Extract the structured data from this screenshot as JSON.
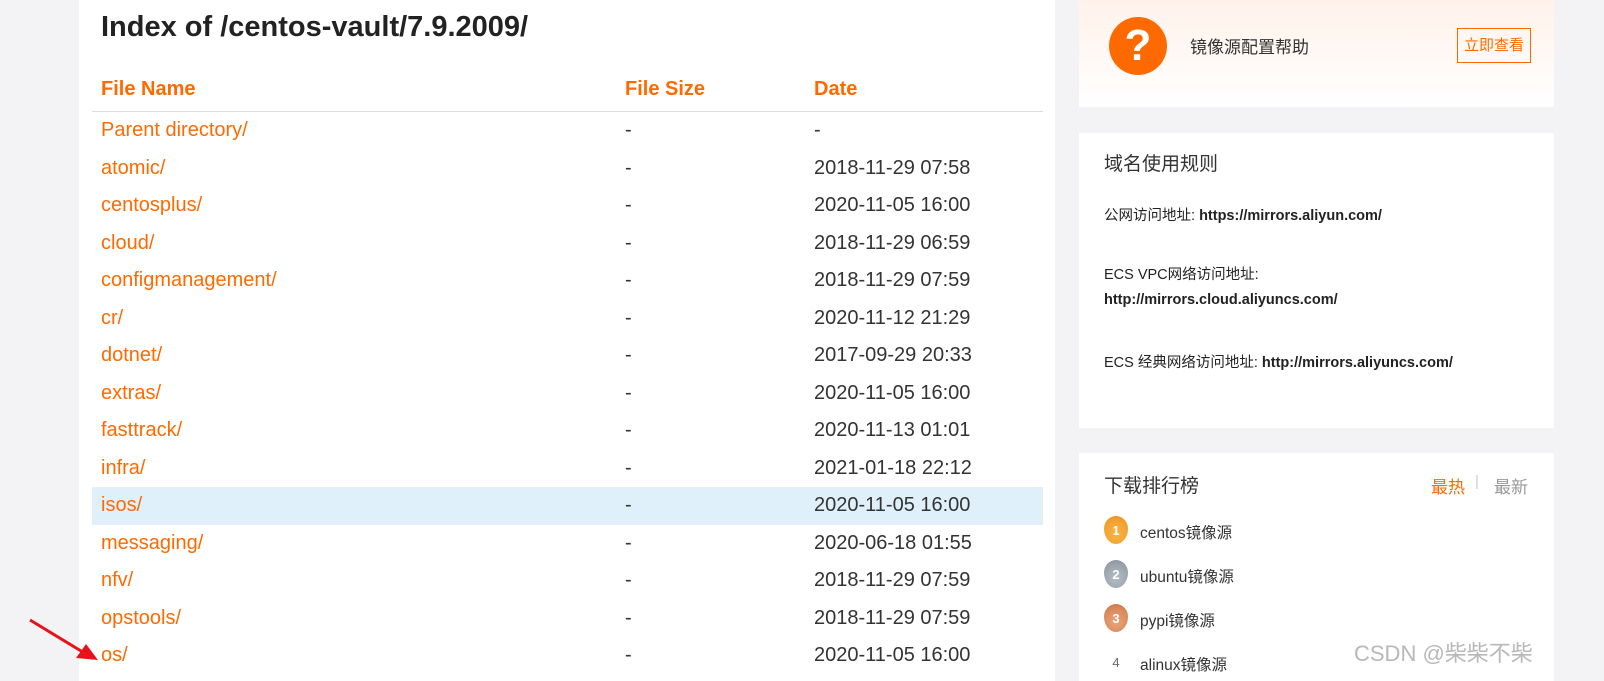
{
  "page_title": "Index of /centos-vault/7.9.2009/",
  "table": {
    "headers": {
      "name": "File Name",
      "size": "File Size",
      "date": "Date"
    },
    "rows": [
      {
        "name": "Parent directory/",
        "size": "-",
        "date": "-"
      },
      {
        "name": "atomic/",
        "size": "-",
        "date": "2018-11-29 07:58"
      },
      {
        "name": "centosplus/",
        "size": "-",
        "date": "2020-11-05 16:00"
      },
      {
        "name": "cloud/",
        "size": "-",
        "date": "2018-11-29 06:59"
      },
      {
        "name": "configmanagement/",
        "size": "-",
        "date": "2018-11-29 07:59"
      },
      {
        "name": "cr/",
        "size": "-",
        "date": "2020-11-12 21:29"
      },
      {
        "name": "dotnet/",
        "size": "-",
        "date": "2017-09-29 20:33"
      },
      {
        "name": "extras/",
        "size": "-",
        "date": "2020-11-05 16:00"
      },
      {
        "name": "fasttrack/",
        "size": "-",
        "date": "2020-11-13 01:01"
      },
      {
        "name": "infra/",
        "size": "-",
        "date": "2021-01-18 22:12"
      },
      {
        "name": "isos/",
        "size": "-",
        "date": "2020-11-05 16:00"
      },
      {
        "name": "messaging/",
        "size": "-",
        "date": "2020-06-18 01:55"
      },
      {
        "name": "nfv/",
        "size": "-",
        "date": "2018-11-29 07:59"
      },
      {
        "name": "opstools/",
        "size": "-",
        "date": "2018-11-29 07:59"
      },
      {
        "name": "os/",
        "size": "-",
        "date": "2020-11-05 16:00"
      }
    ]
  },
  "help": {
    "icon": "question-icon",
    "text": "镜像源配置帮助",
    "button": "立即查看"
  },
  "domain_rules": {
    "title": "域名使用规则",
    "public_label": "公网访问地址: ",
    "public_url": "https://mirrors.aliyun.com/",
    "vpc_label": "ECS VPC网络访问地址:",
    "vpc_url": "http://mirrors.cloud.aliyuncs.com/",
    "classic_label": "ECS 经典网络访问地址: ",
    "classic_url": "http://mirrors.aliyuncs.com/"
  },
  "ranking": {
    "title": "下载排行榜",
    "tab_hot": "最热",
    "tab_sep": "|",
    "tab_new": "最新",
    "items": [
      {
        "rank": "1",
        "label": "centos镜像源"
      },
      {
        "rank": "2",
        "label": "ubuntu镜像源"
      },
      {
        "rank": "3",
        "label": "pypi镜像源"
      },
      {
        "rank": "4",
        "label": "alinux镜像源"
      }
    ]
  },
  "watermark": "CSDN @柴柴不柴",
  "colors": {
    "accent": "#ff6a00",
    "highlight_row": "#e0f0fb",
    "arrow": "#e8131a"
  }
}
